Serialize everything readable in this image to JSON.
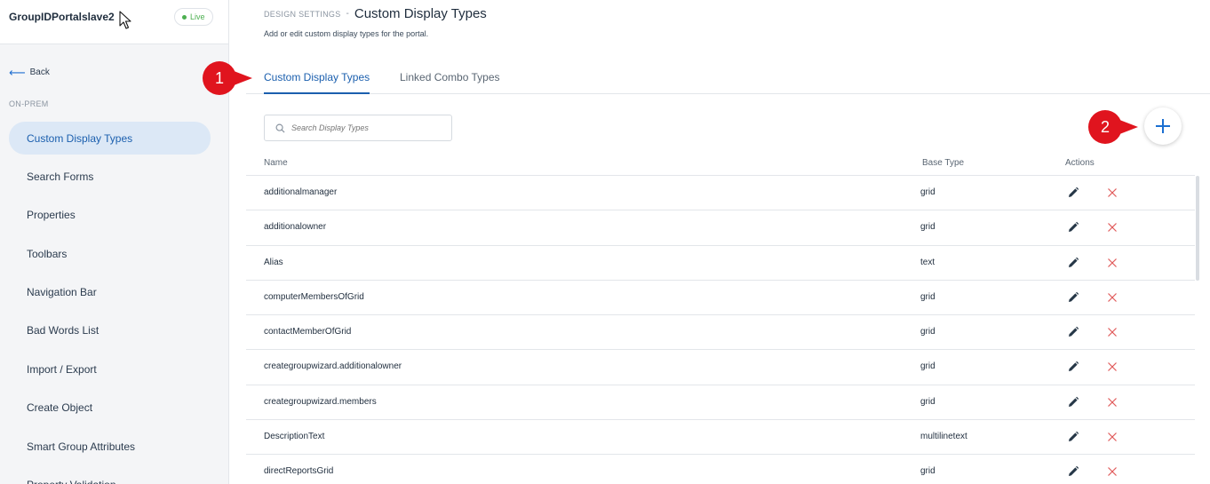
{
  "sidebar": {
    "portal_name": "GroupIDPortalslave2",
    "status_badge": "Live",
    "back_label": "Back",
    "section_label": "ON-PREM",
    "items": [
      {
        "label": "Custom Display Types",
        "active": true
      },
      {
        "label": "Search Forms"
      },
      {
        "label": "Properties"
      },
      {
        "label": "Toolbars"
      },
      {
        "label": "Navigation Bar"
      },
      {
        "label": "Bad Words List"
      },
      {
        "label": "Import / Export"
      },
      {
        "label": "Create Object"
      },
      {
        "label": "Smart Group Attributes"
      },
      {
        "label": "Property Validation"
      }
    ]
  },
  "header": {
    "breadcrumb_parent": "DESIGN SETTINGS",
    "separator": "-",
    "title": "Custom Display Types",
    "subtitle": "Add or edit custom display types for the portal."
  },
  "tabs": [
    {
      "label": "Custom Display Types",
      "active": true
    },
    {
      "label": "Linked Combo Types"
    }
  ],
  "search": {
    "placeholder": "Search Display Types"
  },
  "add_button": {
    "icon": "plus-icon",
    "color": "#1b6fd1"
  },
  "annotations": [
    "1",
    "2"
  ],
  "table": {
    "columns": {
      "name": "Name",
      "base_type": "Base Type",
      "actions": "Actions"
    },
    "rows": [
      {
        "name": "additionalmanager",
        "base_type": "grid"
      },
      {
        "name": "additionalowner",
        "base_type": "grid"
      },
      {
        "name": "Alias",
        "base_type": "text"
      },
      {
        "name": "computerMembersOfGrid",
        "base_type": "grid"
      },
      {
        "name": "contactMemberOfGrid",
        "base_type": "grid"
      },
      {
        "name": "creategroupwizard.additionalowner",
        "base_type": "grid"
      },
      {
        "name": "creategroupwizard.members",
        "base_type": "grid"
      },
      {
        "name": "DescriptionText",
        "base_type": "multilinetext"
      },
      {
        "name": "directReportsGrid",
        "base_type": "grid"
      }
    ]
  },
  "colors": {
    "accent": "#1b5fae",
    "active_nav_bg": "#dce8f6",
    "annotation_red": "#e0141e",
    "delete_red": "#e05a5a",
    "live_green": "#4caf50"
  }
}
